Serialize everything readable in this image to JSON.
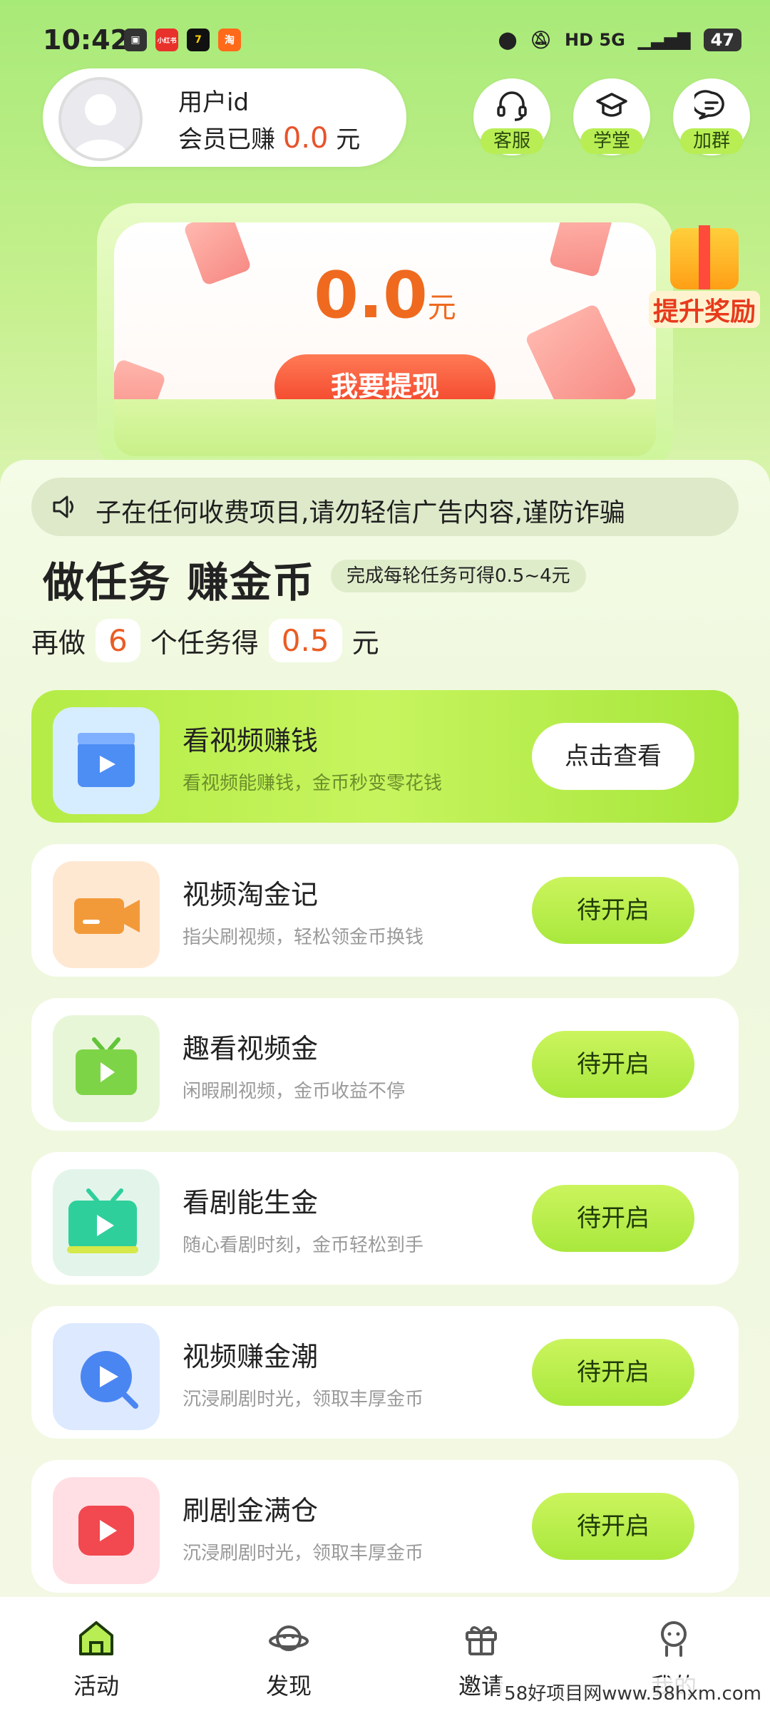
{
  "status_bar": {
    "time": "10:42",
    "apps": [
      "小红书",
      "7",
      "淘"
    ],
    "network": "HD 5G",
    "battery": "47"
  },
  "user": {
    "id_label": "用户id",
    "earned_prefix": "会员已赚",
    "earned_amount": "0.0",
    "earned_unit": "元"
  },
  "top_buttons": [
    {
      "label": "客服",
      "icon": "headset-icon"
    },
    {
      "label": "学堂",
      "icon": "graduation-cap-icon"
    },
    {
      "label": "加群",
      "icon": "chat-bubble-icon"
    }
  ],
  "reward": {
    "amount": "0.0",
    "unit": "元",
    "withdraw_label": "我要提现",
    "boost_label": "提升奖励"
  },
  "notice": {
    "text": "子在任何收费项目,请勿轻信广告内容,谨防诈骗"
  },
  "section": {
    "title": "做任务 赚金币",
    "subtitle": "完成每轮任务可得0.5~4元",
    "progress_prefix": "再做",
    "tasks_left": "6",
    "progress_middle": "个任务得",
    "reward_value": "0.5",
    "progress_suffix": "元"
  },
  "tasks": [
    {
      "title": "看视频赚钱",
      "desc": "看视频能赚钱，金币秒变零花钱",
      "button": "点击查看",
      "icon": "clapperboard-icon",
      "icon_bg": "#d6ecff"
    },
    {
      "title": "视频淘金记",
      "desc": "指尖刷视频，轻松领金币换钱",
      "button": "待开启",
      "icon": "video-camera-icon",
      "icon_bg": "#ffe8d2"
    },
    {
      "title": "趣看视频金",
      "desc": "闲暇刷视频，金币收益不停",
      "button": "待开启",
      "icon": "tv-icon",
      "icon_bg": "#e8f6d8"
    },
    {
      "title": "看剧能生金",
      "desc": "随心看剧时刻，金币轻松到手",
      "button": "待开启",
      "icon": "tv-play-icon",
      "icon_bg": "#e3f5ea"
    },
    {
      "title": "视频赚金潮",
      "desc": "沉浸刷剧时光，领取丰厚金币",
      "button": "待开启",
      "icon": "play-circle-icon",
      "icon_bg": "#dde9ff"
    },
    {
      "title": "刷剧金满仓",
      "desc": "沉浸刷剧时光，领取丰厚金币",
      "button": "待开启",
      "icon": "play-square-icon",
      "icon_bg": "#ffdfe4"
    }
  ],
  "nav": [
    {
      "label": "活动",
      "icon": "home-icon"
    },
    {
      "label": "发现",
      "icon": "planet-icon"
    },
    {
      "label": "邀请",
      "icon": "gift-icon"
    },
    {
      "label": "我的",
      "icon": "profile-icon"
    }
  ],
  "watermark": "58好项目网www.58hxm.com",
  "colors": {
    "accent_green": "#b5ec46",
    "amount_orange": "#ef6a1e",
    "withdraw_red": "#f03b22"
  }
}
